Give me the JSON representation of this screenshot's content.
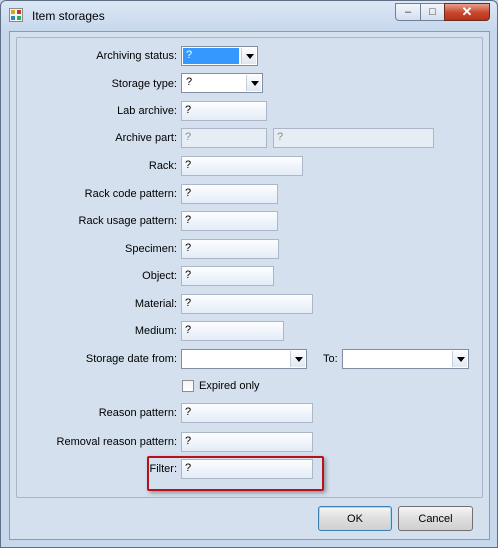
{
  "window": {
    "title": "Item storages",
    "icon": "app-grid-icon"
  },
  "form": {
    "archiving_status": {
      "label": "Archiving status:",
      "value": "?"
    },
    "storage_type": {
      "label": "Storage type:",
      "value": "?"
    },
    "lab_archive": {
      "label": "Lab archive:",
      "value": "?"
    },
    "archive_part": {
      "label": "Archive part:",
      "value1": "?",
      "value2": "?"
    },
    "rack": {
      "label": "Rack:",
      "value": "?"
    },
    "rack_code_pattern": {
      "label": "Rack code pattern:",
      "value": "?"
    },
    "rack_usage_pattern": {
      "label": "Rack usage pattern:",
      "value": "?"
    },
    "specimen": {
      "label": "Specimen:",
      "value": "?"
    },
    "object": {
      "label": "Object:",
      "value": "?"
    },
    "material": {
      "label": "Material:",
      "value": "?"
    },
    "medium": {
      "label": "Medium:",
      "value": "?"
    },
    "storage_date": {
      "label": "Storage date from:",
      "to_label": "To:",
      "from_value": "",
      "to_value": ""
    },
    "expired_only": {
      "label": "Expired only",
      "checked": false
    },
    "reason_pattern": {
      "label": "Reason pattern:",
      "value": "?"
    },
    "removal_reason_pattern": {
      "label": "Removal reason pattern:",
      "value": "?"
    },
    "filter": {
      "label": "Filter:",
      "value": "?"
    }
  },
  "buttons": {
    "ok": "OK",
    "cancel": "Cancel"
  },
  "colors": {
    "highlight": "#b5121b",
    "selection": "#3399ff"
  }
}
